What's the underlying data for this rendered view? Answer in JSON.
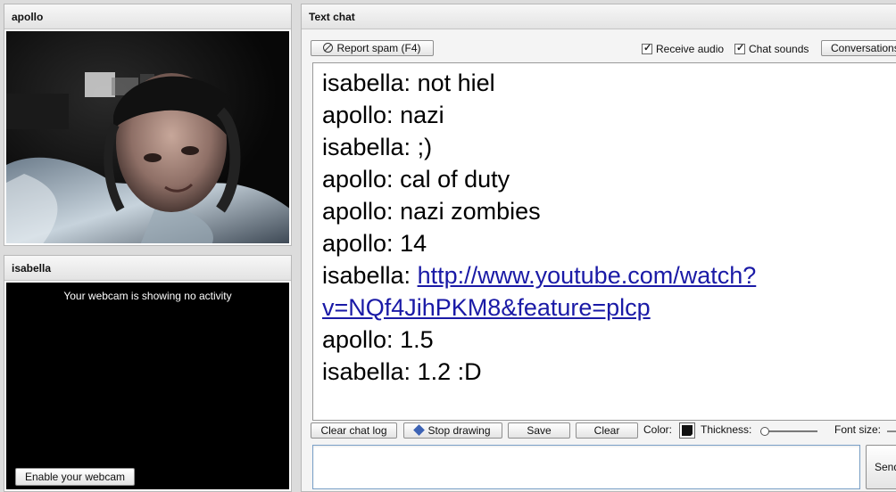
{
  "panels": {
    "apollo_title": "apollo",
    "isabella_title": "isabella",
    "chat_title": "Text chat"
  },
  "isabella_video": {
    "no_activity_text": "Your webcam is showing no activity",
    "enable_button": "Enable your webcam"
  },
  "toolbar": {
    "report_spam": "Report spam (F4)",
    "receive_audio": "Receive audio",
    "chat_sounds": "Chat sounds",
    "conversations": "Conversations"
  },
  "messages": [
    {
      "sender": "isabella",
      "text": "isabella: not hiel"
    },
    {
      "sender": "apollo",
      "text": "apollo: nazi"
    },
    {
      "sender": "isabella",
      "text": "isabella: ;)"
    },
    {
      "sender": "apollo",
      "text": "apollo: cal of duty"
    },
    {
      "sender": "apollo",
      "text": "apollo: nazi zombies"
    },
    {
      "sender": "apollo",
      "text": "apollo: 14"
    },
    {
      "sender": "isabella",
      "prefix": "isabella: ",
      "link_line1": "http://www.youtube.com/watch?",
      "link_line2": "v=NQf4JihPKM8&feature=plcp"
    },
    {
      "sender": "apollo",
      "text": "apollo: 1.5"
    },
    {
      "sender": "isabella",
      "text": "isabella: 1.2 :D"
    }
  ],
  "drawing": {
    "clear_chat_log": "Clear chat log",
    "stop_drawing": "Stop drawing",
    "save": "Save",
    "clear": "Clear",
    "color_label": "Color:",
    "thickness_label": "Thickness:",
    "font_size_label": "Font size:",
    "thickness_fraction": 0.0
  },
  "input": {
    "value": "",
    "send": "Send"
  },
  "colors": {
    "link": "#1a1aa6",
    "panel_bg": "#dcdcdc",
    "video_bg": "#000000"
  }
}
